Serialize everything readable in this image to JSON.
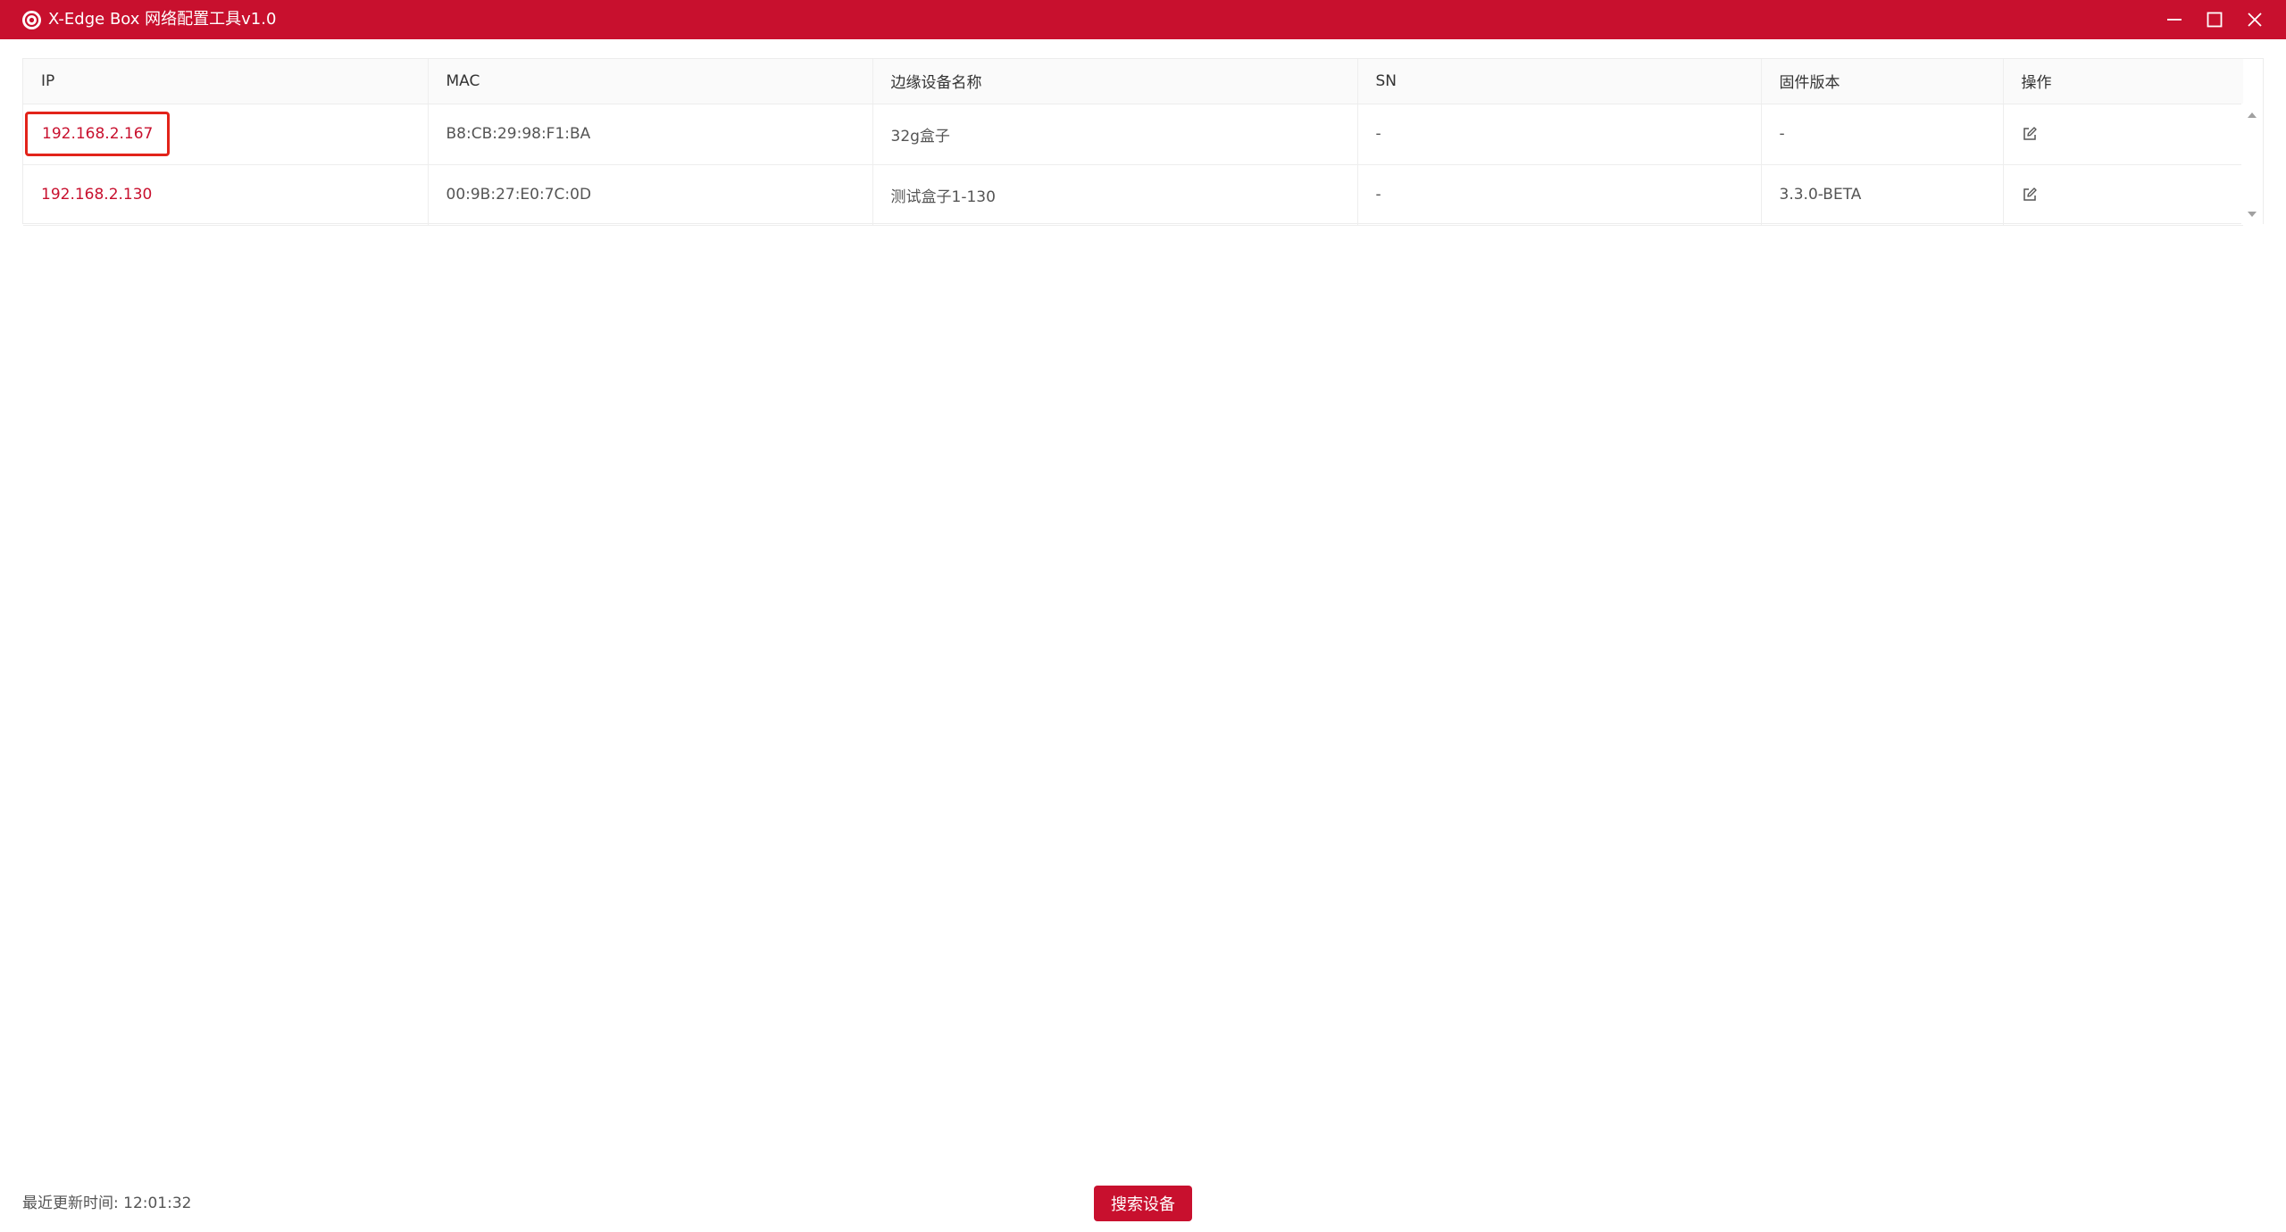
{
  "window": {
    "title": "X-Edge Box 网络配置工具v1.0",
    "brand_color": "#c8102e"
  },
  "table": {
    "headers": [
      "IP",
      "MAC",
      "边缘设备名称",
      "SN",
      "固件版本",
      "操作"
    ],
    "rows": [
      {
        "ip": "192.168.2.167",
        "mac": "B8:CB:29:98:F1:BA",
        "name": "32g盒子",
        "sn": "-",
        "firmware": "-",
        "action_icon": "edit-icon"
      },
      {
        "ip": "192.168.2.130",
        "mac": "00:9B:27:E0:7C:0D",
        "name": "测试盒子1-130",
        "sn": "-",
        "firmware": "3.3.0-BETA",
        "action_icon": "edit-icon"
      }
    ]
  },
  "footer": {
    "last_update": "最近更新时间: 12:01:32",
    "search_button": "搜索设备"
  }
}
